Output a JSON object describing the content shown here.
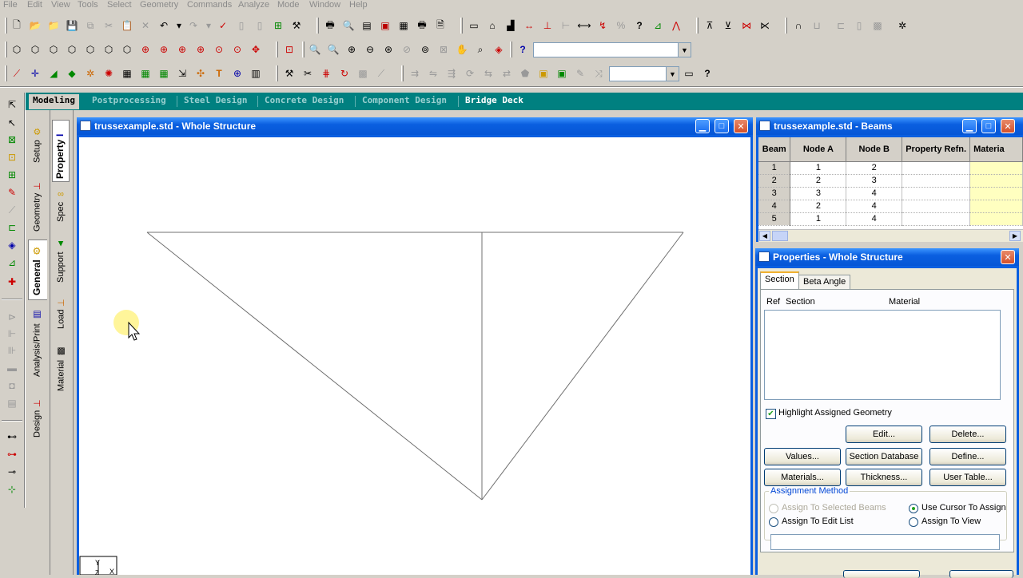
{
  "menu": [
    "File",
    "Edit",
    "View",
    "Tools",
    "Select",
    "Geometry",
    "Commands",
    "Analyze",
    "Mode",
    "Window",
    "Help"
  ],
  "mode_tabs": [
    {
      "label": "Modeling",
      "active": true
    },
    {
      "label": "Postprocessing",
      "active": false
    },
    {
      "label": "Steel Design",
      "active": false
    },
    {
      "label": "Concrete Design",
      "active": false
    },
    {
      "label": "Component Design",
      "active": false
    },
    {
      "label": "Bridge Deck",
      "active": false
    }
  ],
  "page_tabs": {
    "outer": [
      "Setup",
      "Geometry",
      "General",
      "Analysis/Print",
      "Design"
    ],
    "inner": [
      "Property",
      "Spec",
      "Support",
      "Load",
      "Material"
    ]
  },
  "viewport": {
    "title": "trussexample.std - Whole Structure",
    "axis": {
      "y": "Y",
      "z": "Z",
      "x": "X"
    }
  },
  "beams_table": {
    "title": "trussexample.std - Beams",
    "columns": [
      "Beam",
      "Node A",
      "Node B",
      "Property Refn.",
      "Materia"
    ],
    "rows": [
      [
        "1",
        "1",
        "2",
        "",
        ""
      ],
      [
        "2",
        "2",
        "3",
        "",
        ""
      ],
      [
        "3",
        "3",
        "4",
        "",
        ""
      ],
      [
        "4",
        "2",
        "4",
        "",
        ""
      ],
      [
        "5",
        "1",
        "4",
        "",
        ""
      ]
    ]
  },
  "properties": {
    "title": "Properties - Whole Structure",
    "tabs": [
      "Section",
      "Beta Angle"
    ],
    "list_headers": [
      "Ref",
      "Section",
      "Material"
    ],
    "highlight_label": "Highlight Assigned Geometry",
    "highlight_checked": true,
    "buttons": {
      "edit": "Edit...",
      "delete": "Delete...",
      "values": "Values...",
      "section_db": "Section Database",
      "define": "Define...",
      "materials": "Materials...",
      "thickness": "Thickness...",
      "user_table": "User Table..."
    },
    "assignment": {
      "legend": "Assignment Method",
      "to_selected": "Assign To Selected Beams",
      "cursor": "Use Cursor To Assign",
      "edit_list": "Assign To Edit List",
      "to_view": "Assign To View",
      "selected": "Use Cursor To Assign"
    },
    "assign_field": ""
  },
  "colors": {
    "accent": "#0a5fe0",
    "mode_bar": "#008080",
    "cursor_highlight": "#fff59a"
  },
  "icons": [
    "new-file-icon",
    "open-icon",
    "save-icon",
    "print-icon",
    "help-icon",
    "zoom-in-icon",
    "zoom-out-icon",
    "pan-icon",
    "rotate-icon",
    "cursor-icon"
  ]
}
